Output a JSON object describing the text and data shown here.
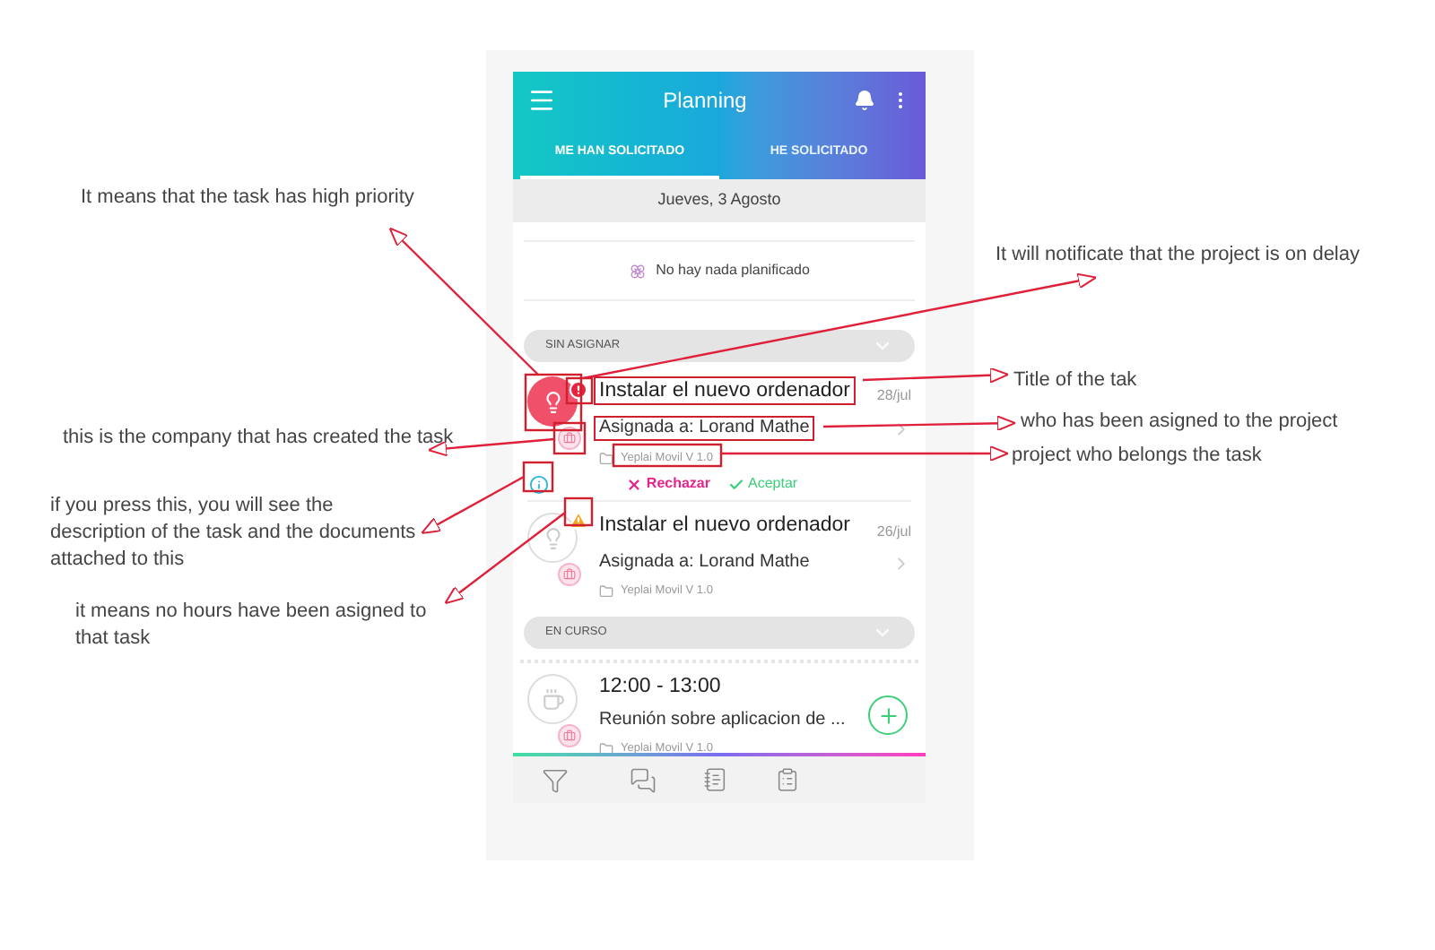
{
  "app_bar": {
    "title": "Planning"
  },
  "tabs": [
    {
      "label": "ME HAN SOLICITADO",
      "selected": true
    },
    {
      "label": "HE SOLICITADO",
      "selected": false
    }
  ],
  "date": "Jueves, 3 Agosto",
  "empty_state": "No hay nada planificado",
  "sections": [
    {
      "title": "SIN ASIGNAR",
      "tasks": [
        {
          "kind": "task",
          "title": "Instalar el nuevo ordenador",
          "date": "28/jul",
          "assignee": "Asignada a: Lorand Mathe",
          "project": "Yeplai Movil V 1.0",
          "high_priority": true,
          "delayed": true,
          "hours_missing": false,
          "actions": [
            {
              "kind": "reject",
              "label": "Rechazar"
            },
            {
              "kind": "accept",
              "label": "Aceptar"
            }
          ]
        },
        {
          "kind": "task",
          "title": "Instalar el nuevo ordenador",
          "date": "26/jul",
          "assignee": "Asignada a: Lorand Mathe",
          "project": "Yeplai Movil V 1.0",
          "high_priority": false,
          "delayed": false,
          "hours_missing": true
        }
      ]
    },
    {
      "title": "EN CURSO",
      "tasks": [
        {
          "kind": "meeting",
          "title": "12:00 - 13:00",
          "assignee": "Reunión sobre aplicacion de ...",
          "project": "Yeplai Movil V 1.0",
          "high_priority": false,
          "delayed": false,
          "hours_missing": false
        }
      ]
    }
  ],
  "annotations": [
    "It means that the task has high priority",
    "It will notificate that the project is on delay",
    "Title of the tak",
    "who has been asigned to the project",
    "project who belongs the task",
    "this is the company that has created the task",
    "if you press this, you will see the description of the task and the documents attached to this",
    "it means no hours have been asigned to that task"
  ]
}
